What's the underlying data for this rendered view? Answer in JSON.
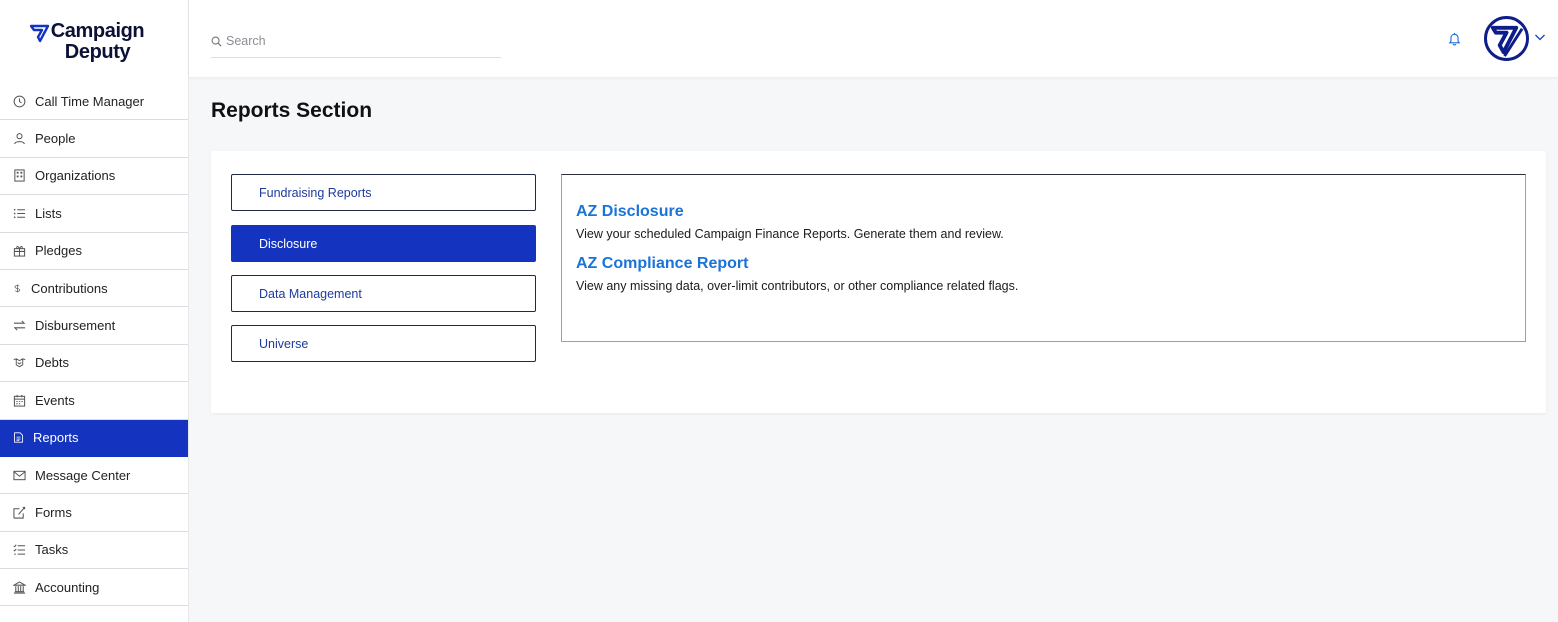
{
  "brand": {
    "line1": "Campaign",
    "line2": "Deputy"
  },
  "sidebar": {
    "items": [
      {
        "label": "Call Time Manager",
        "icon": "clock-icon"
      },
      {
        "label": "People",
        "icon": "person-icon"
      },
      {
        "label": "Organizations",
        "icon": "building-icon"
      },
      {
        "label": "Lists",
        "icon": "list-icon"
      },
      {
        "label": "Pledges",
        "icon": "gift-icon"
      },
      {
        "label": "Contributions",
        "icon": "dollar-icon"
      },
      {
        "label": "Disbursement",
        "icon": "transfer-icon"
      },
      {
        "label": "Debts",
        "icon": "handshake-icon"
      },
      {
        "label": "Events",
        "icon": "calendar-icon"
      },
      {
        "label": "Reports",
        "icon": "document-icon",
        "active": true
      },
      {
        "label": "Message Center",
        "icon": "envelope-icon"
      },
      {
        "label": "Forms",
        "icon": "form-icon"
      },
      {
        "label": "Tasks",
        "icon": "checklist-icon"
      },
      {
        "label": "Accounting",
        "icon": "bank-icon"
      }
    ]
  },
  "header": {
    "search_placeholder": "Search"
  },
  "main": {
    "title": "Reports Section",
    "tabs": [
      {
        "label": "Fundraising Reports",
        "active": false
      },
      {
        "label": "Disclosure",
        "active": true
      },
      {
        "label": "Data Management",
        "active": false
      },
      {
        "label": "Universe",
        "active": false
      }
    ],
    "reports": [
      {
        "title": "AZ Disclosure",
        "description": "View your scheduled Campaign Finance Reports. Generate them and review."
      },
      {
        "title": "AZ Compliance Report",
        "description": "View any missing data, over-limit contributors, or other compliance related flags."
      }
    ]
  },
  "colors": {
    "primary": "#1434c0",
    "link": "#1a73d8",
    "brand_dark": "#0b1236"
  }
}
